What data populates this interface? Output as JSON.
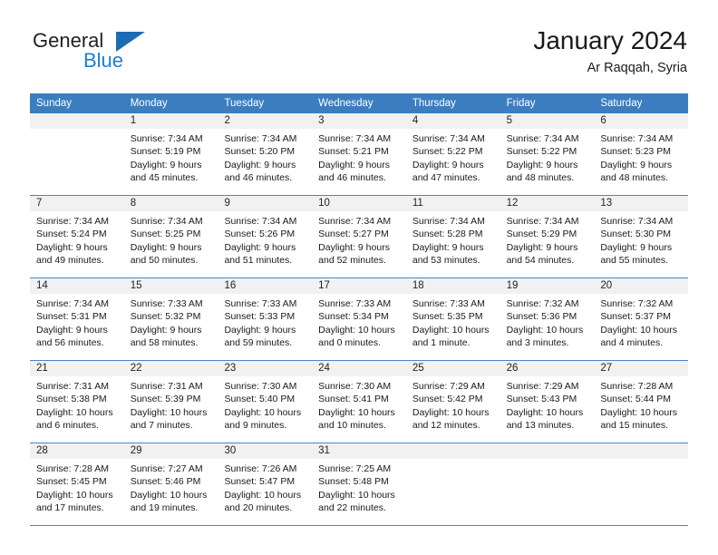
{
  "brand": {
    "name_top": "General",
    "name_bottom": "Blue",
    "triangle_color": "#1b6cb5",
    "blue_color": "#1b7fd4"
  },
  "header": {
    "title": "January 2024",
    "subtitle": "Ar Raqqah, Syria"
  },
  "colors": {
    "header_row_bg": "#3b7dbf",
    "header_row_text": "#ffffff",
    "daynum_bg": "#f1f1f1",
    "row_divider": "#4a86c4"
  },
  "weekdays": [
    "Sunday",
    "Monday",
    "Tuesday",
    "Wednesday",
    "Thursday",
    "Friday",
    "Saturday"
  ],
  "weeks": [
    [
      {
        "day": "",
        "empty": true,
        "sunrise": "",
        "sunset": "",
        "daylight1": "",
        "daylight2": ""
      },
      {
        "day": "1",
        "sunrise": "Sunrise: 7:34 AM",
        "sunset": "Sunset: 5:19 PM",
        "daylight1": "Daylight: 9 hours",
        "daylight2": "and 45 minutes."
      },
      {
        "day": "2",
        "sunrise": "Sunrise: 7:34 AM",
        "sunset": "Sunset: 5:20 PM",
        "daylight1": "Daylight: 9 hours",
        "daylight2": "and 46 minutes."
      },
      {
        "day": "3",
        "sunrise": "Sunrise: 7:34 AM",
        "sunset": "Sunset: 5:21 PM",
        "daylight1": "Daylight: 9 hours",
        "daylight2": "and 46 minutes."
      },
      {
        "day": "4",
        "sunrise": "Sunrise: 7:34 AM",
        "sunset": "Sunset: 5:22 PM",
        "daylight1": "Daylight: 9 hours",
        "daylight2": "and 47 minutes."
      },
      {
        "day": "5",
        "sunrise": "Sunrise: 7:34 AM",
        "sunset": "Sunset: 5:22 PM",
        "daylight1": "Daylight: 9 hours",
        "daylight2": "and 48 minutes."
      },
      {
        "day": "6",
        "sunrise": "Sunrise: 7:34 AM",
        "sunset": "Sunset: 5:23 PM",
        "daylight1": "Daylight: 9 hours",
        "daylight2": "and 48 minutes."
      }
    ],
    [
      {
        "day": "7",
        "sunrise": "Sunrise: 7:34 AM",
        "sunset": "Sunset: 5:24 PM",
        "daylight1": "Daylight: 9 hours",
        "daylight2": "and 49 minutes."
      },
      {
        "day": "8",
        "sunrise": "Sunrise: 7:34 AM",
        "sunset": "Sunset: 5:25 PM",
        "daylight1": "Daylight: 9 hours",
        "daylight2": "and 50 minutes."
      },
      {
        "day": "9",
        "sunrise": "Sunrise: 7:34 AM",
        "sunset": "Sunset: 5:26 PM",
        "daylight1": "Daylight: 9 hours",
        "daylight2": "and 51 minutes."
      },
      {
        "day": "10",
        "sunrise": "Sunrise: 7:34 AM",
        "sunset": "Sunset: 5:27 PM",
        "daylight1": "Daylight: 9 hours",
        "daylight2": "and 52 minutes."
      },
      {
        "day": "11",
        "sunrise": "Sunrise: 7:34 AM",
        "sunset": "Sunset: 5:28 PM",
        "daylight1": "Daylight: 9 hours",
        "daylight2": "and 53 minutes."
      },
      {
        "day": "12",
        "sunrise": "Sunrise: 7:34 AM",
        "sunset": "Sunset: 5:29 PM",
        "daylight1": "Daylight: 9 hours",
        "daylight2": "and 54 minutes."
      },
      {
        "day": "13",
        "sunrise": "Sunrise: 7:34 AM",
        "sunset": "Sunset: 5:30 PM",
        "daylight1": "Daylight: 9 hours",
        "daylight2": "and 55 minutes."
      }
    ],
    [
      {
        "day": "14",
        "sunrise": "Sunrise: 7:34 AM",
        "sunset": "Sunset: 5:31 PM",
        "daylight1": "Daylight: 9 hours",
        "daylight2": "and 56 minutes."
      },
      {
        "day": "15",
        "sunrise": "Sunrise: 7:33 AM",
        "sunset": "Sunset: 5:32 PM",
        "daylight1": "Daylight: 9 hours",
        "daylight2": "and 58 minutes."
      },
      {
        "day": "16",
        "sunrise": "Sunrise: 7:33 AM",
        "sunset": "Sunset: 5:33 PM",
        "daylight1": "Daylight: 9 hours",
        "daylight2": "and 59 minutes."
      },
      {
        "day": "17",
        "sunrise": "Sunrise: 7:33 AM",
        "sunset": "Sunset: 5:34 PM",
        "daylight1": "Daylight: 10 hours",
        "daylight2": "and 0 minutes."
      },
      {
        "day": "18",
        "sunrise": "Sunrise: 7:33 AM",
        "sunset": "Sunset: 5:35 PM",
        "daylight1": "Daylight: 10 hours",
        "daylight2": "and 1 minute."
      },
      {
        "day": "19",
        "sunrise": "Sunrise: 7:32 AM",
        "sunset": "Sunset: 5:36 PM",
        "daylight1": "Daylight: 10 hours",
        "daylight2": "and 3 minutes."
      },
      {
        "day": "20",
        "sunrise": "Sunrise: 7:32 AM",
        "sunset": "Sunset: 5:37 PM",
        "daylight1": "Daylight: 10 hours",
        "daylight2": "and 4 minutes."
      }
    ],
    [
      {
        "day": "21",
        "sunrise": "Sunrise: 7:31 AM",
        "sunset": "Sunset: 5:38 PM",
        "daylight1": "Daylight: 10 hours",
        "daylight2": "and 6 minutes."
      },
      {
        "day": "22",
        "sunrise": "Sunrise: 7:31 AM",
        "sunset": "Sunset: 5:39 PM",
        "daylight1": "Daylight: 10 hours",
        "daylight2": "and 7 minutes."
      },
      {
        "day": "23",
        "sunrise": "Sunrise: 7:30 AM",
        "sunset": "Sunset: 5:40 PM",
        "daylight1": "Daylight: 10 hours",
        "daylight2": "and 9 minutes."
      },
      {
        "day": "24",
        "sunrise": "Sunrise: 7:30 AM",
        "sunset": "Sunset: 5:41 PM",
        "daylight1": "Daylight: 10 hours",
        "daylight2": "and 10 minutes."
      },
      {
        "day": "25",
        "sunrise": "Sunrise: 7:29 AM",
        "sunset": "Sunset: 5:42 PM",
        "daylight1": "Daylight: 10 hours",
        "daylight2": "and 12 minutes."
      },
      {
        "day": "26",
        "sunrise": "Sunrise: 7:29 AM",
        "sunset": "Sunset: 5:43 PM",
        "daylight1": "Daylight: 10 hours",
        "daylight2": "and 13 minutes."
      },
      {
        "day": "27",
        "sunrise": "Sunrise: 7:28 AM",
        "sunset": "Sunset: 5:44 PM",
        "daylight1": "Daylight: 10 hours",
        "daylight2": "and 15 minutes."
      }
    ],
    [
      {
        "day": "28",
        "sunrise": "Sunrise: 7:28 AM",
        "sunset": "Sunset: 5:45 PM",
        "daylight1": "Daylight: 10 hours",
        "daylight2": "and 17 minutes."
      },
      {
        "day": "29",
        "sunrise": "Sunrise: 7:27 AM",
        "sunset": "Sunset: 5:46 PM",
        "daylight1": "Daylight: 10 hours",
        "daylight2": "and 19 minutes."
      },
      {
        "day": "30",
        "sunrise": "Sunrise: 7:26 AM",
        "sunset": "Sunset: 5:47 PM",
        "daylight1": "Daylight: 10 hours",
        "daylight2": "and 20 minutes."
      },
      {
        "day": "31",
        "sunrise": "Sunrise: 7:25 AM",
        "sunset": "Sunset: 5:48 PM",
        "daylight1": "Daylight: 10 hours",
        "daylight2": "and 22 minutes."
      },
      {
        "day": "",
        "empty": true,
        "sunrise": "",
        "sunset": "",
        "daylight1": "",
        "daylight2": ""
      },
      {
        "day": "",
        "empty": true,
        "sunrise": "",
        "sunset": "",
        "daylight1": "",
        "daylight2": ""
      },
      {
        "day": "",
        "empty": true,
        "sunrise": "",
        "sunset": "",
        "daylight1": "",
        "daylight2": ""
      }
    ]
  ]
}
